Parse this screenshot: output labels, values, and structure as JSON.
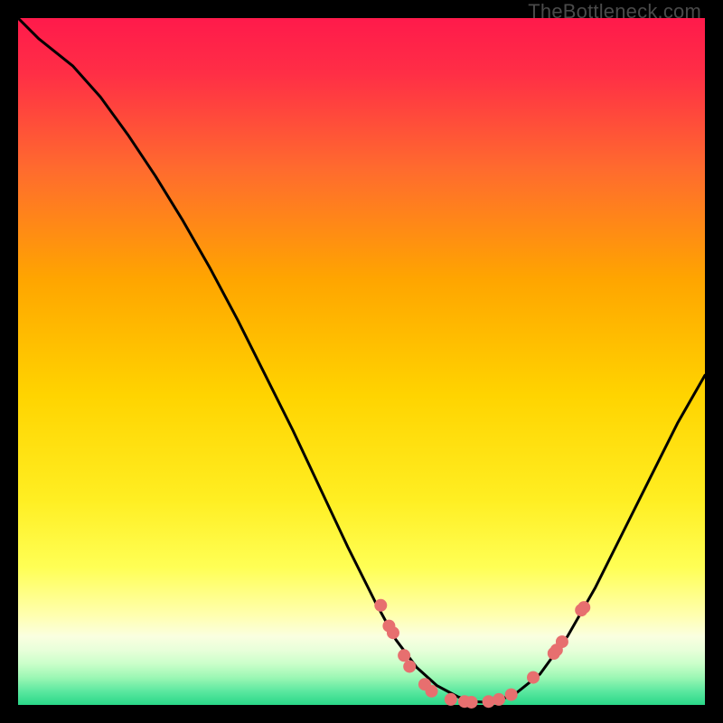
{
  "watermark": "TheBottleneck.com",
  "colors": {
    "red": "#ff1a4b",
    "orange": "#ffa500",
    "yellow": "#ffff33",
    "paleyellow": "#ffffb0",
    "green": "#2bd88a",
    "curve": "#000000",
    "dot": "#e76f6f"
  },
  "chart_data": {
    "type": "line",
    "title": "",
    "xlabel": "",
    "ylabel": "",
    "xlim": [
      0,
      100
    ],
    "ylim": [
      0,
      100
    ],
    "curve": {
      "x": [
        0,
        3,
        8,
        12,
        16,
        20,
        24,
        28,
        32,
        36,
        40,
        44,
        48,
        52,
        55,
        58,
        61,
        64,
        66,
        68,
        72,
        76,
        80,
        84,
        88,
        92,
        96,
        100
      ],
      "y": [
        100,
        97,
        93,
        88.5,
        83,
        77,
        70.5,
        63.5,
        56,
        48,
        40,
        31.5,
        23,
        15,
        9.5,
        5.5,
        2.8,
        1.2,
        0.5,
        0.4,
        1.3,
        4.5,
        10,
        17,
        25,
        33,
        41,
        48
      ]
    },
    "dots": [
      {
        "x": 52.8,
        "y": 14.5
      },
      {
        "x": 54.0,
        "y": 11.5
      },
      {
        "x": 54.6,
        "y": 10.5
      },
      {
        "x": 56.2,
        "y": 7.2
      },
      {
        "x": 57.0,
        "y": 5.6
      },
      {
        "x": 59.2,
        "y": 3.0
      },
      {
        "x": 60.2,
        "y": 2.0
      },
      {
        "x": 63.0,
        "y": 0.8
      },
      {
        "x": 65.0,
        "y": 0.5
      },
      {
        "x": 66.0,
        "y": 0.4
      },
      {
        "x": 68.5,
        "y": 0.5
      },
      {
        "x": 70.0,
        "y": 0.8
      },
      {
        "x": 71.8,
        "y": 1.5
      },
      {
        "x": 75.0,
        "y": 4.0
      },
      {
        "x": 78.0,
        "y": 7.5
      },
      {
        "x": 78.4,
        "y": 8.0
      },
      {
        "x": 79.2,
        "y": 9.2
      },
      {
        "x": 82.0,
        "y": 13.8
      },
      {
        "x": 82.4,
        "y": 14.2
      }
    ]
  }
}
